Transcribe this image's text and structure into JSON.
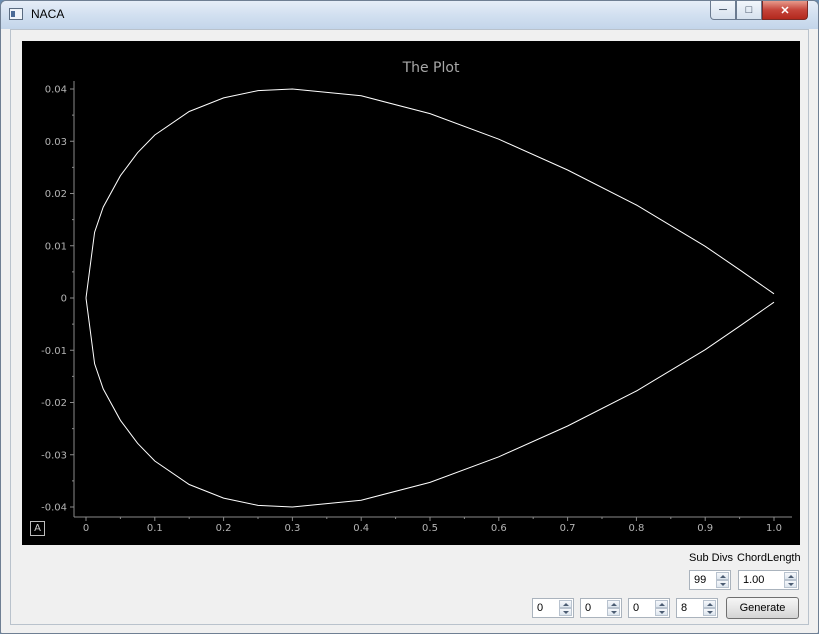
{
  "window": {
    "title": "NACA"
  },
  "plot_title": "The Plot",
  "controls": {
    "sub_divs_label": "Sub Divs",
    "chord_length_label": "ChordLength",
    "sub_divs_value": "99",
    "chord_length_value": "1.00",
    "naca_digits": [
      "0",
      "0",
      "0",
      "8"
    ],
    "generate_label": "Generate"
  },
  "chart_data": {
    "type": "line",
    "title": "The Plot",
    "xlabel": "",
    "ylabel": "",
    "xlim": [
      0,
      1.0
    ],
    "ylim": [
      -0.04,
      0.04
    ],
    "x_ticks": [
      "0",
      "0.1",
      "0.2",
      "0.3",
      "0.4",
      "0.5",
      "0.6",
      "0.7",
      "0.8",
      "0.9",
      "1.0"
    ],
    "y_ticks": [
      "0.04",
      "0.03",
      "0.02",
      "0.01",
      "0",
      "-0.01",
      "-0.02",
      "-0.03",
      "-0.04"
    ],
    "grid": false,
    "series": [
      {
        "values_x": [
          0,
          0.0125,
          0.025,
          0.05,
          0.075,
          0.1,
          0.15,
          0.2,
          0.25,
          0.3,
          0.4,
          0.5,
          0.6,
          0.7,
          0.8,
          0.9,
          0.95,
          1.0
        ],
        "values_y": [
          0,
          0.0126,
          0.0174,
          0.0234,
          0.0278,
          0.0312,
          0.0357,
          0.0383,
          0.0397,
          0.04,
          0.0387,
          0.0353,
          0.0304,
          0.0245,
          0.0178,
          0.0099,
          0.0054,
          0.0008
        ]
      },
      {
        "values_x": [
          0,
          0.0125,
          0.025,
          0.05,
          0.075,
          0.1,
          0.15,
          0.2,
          0.25,
          0.3,
          0.4,
          0.5,
          0.6,
          0.7,
          0.8,
          0.9,
          0.95,
          1.0
        ],
        "values_y": [
          0,
          -0.0126,
          -0.0174,
          -0.0234,
          -0.0278,
          -0.0312,
          -0.0357,
          -0.0383,
          -0.0397,
          -0.04,
          -0.0387,
          -0.0353,
          -0.0304,
          -0.0245,
          -0.0178,
          -0.0099,
          -0.0054,
          -0.0008
        ]
      }
    ],
    "colors": {
      "background": "#000000",
      "line": "#ffffff",
      "axis": "#8a8a8a"
    }
  }
}
